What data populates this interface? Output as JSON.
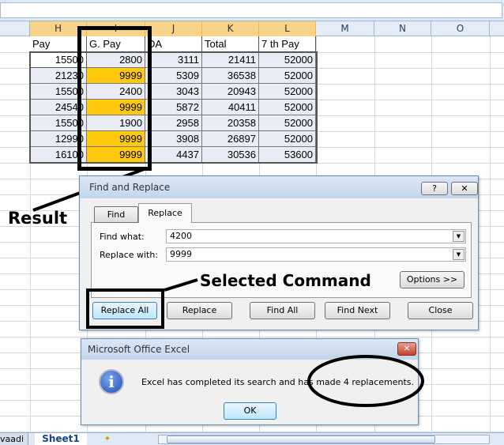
{
  "columns": [
    "H",
    "I",
    "J",
    "K",
    "L",
    "M",
    "N",
    "O"
  ],
  "table": {
    "headers": [
      "Pay",
      "G. Pay",
      "DA",
      "Total",
      "7 th Pay"
    ],
    "rows": [
      [
        "15500",
        "2800",
        "3111",
        "21411",
        "52000"
      ],
      [
        "21230",
        "9999",
        "5309",
        "36538",
        "52000"
      ],
      [
        "15500",
        "2400",
        "3043",
        "20943",
        "52000"
      ],
      [
        "24540",
        "9999",
        "5872",
        "40411",
        "52000"
      ],
      [
        "15500",
        "1900",
        "2958",
        "20358",
        "52000"
      ],
      [
        "12990",
        "9999",
        "3908",
        "26897",
        "52000"
      ],
      [
        "16100",
        "9999",
        "4437",
        "30536",
        "53600"
      ]
    ],
    "highlight_color": "#ffc90e"
  },
  "find_replace": {
    "title": "Find and Replace",
    "help": "?",
    "close": "✕",
    "tabs": [
      "Find",
      "Replace"
    ],
    "active_tab": "Replace",
    "find_label": "Find what:",
    "find_value": "4200",
    "replace_label": "Replace with:",
    "replace_value": "9999",
    "options": "Options >>",
    "buttons": [
      "Replace All",
      "Replace",
      "Find All",
      "Find Next",
      "Close"
    ]
  },
  "message_box": {
    "title": "Microsoft Office Excel",
    "message": "Excel has completed its search and has made 4 replacements.",
    "ok": "OK",
    "icon": "info-icon"
  },
  "sheet_tabs": [
    "vaadi",
    "Sheet1"
  ],
  "annotations": {
    "result": "Result",
    "selected": "Selected Command"
  }
}
